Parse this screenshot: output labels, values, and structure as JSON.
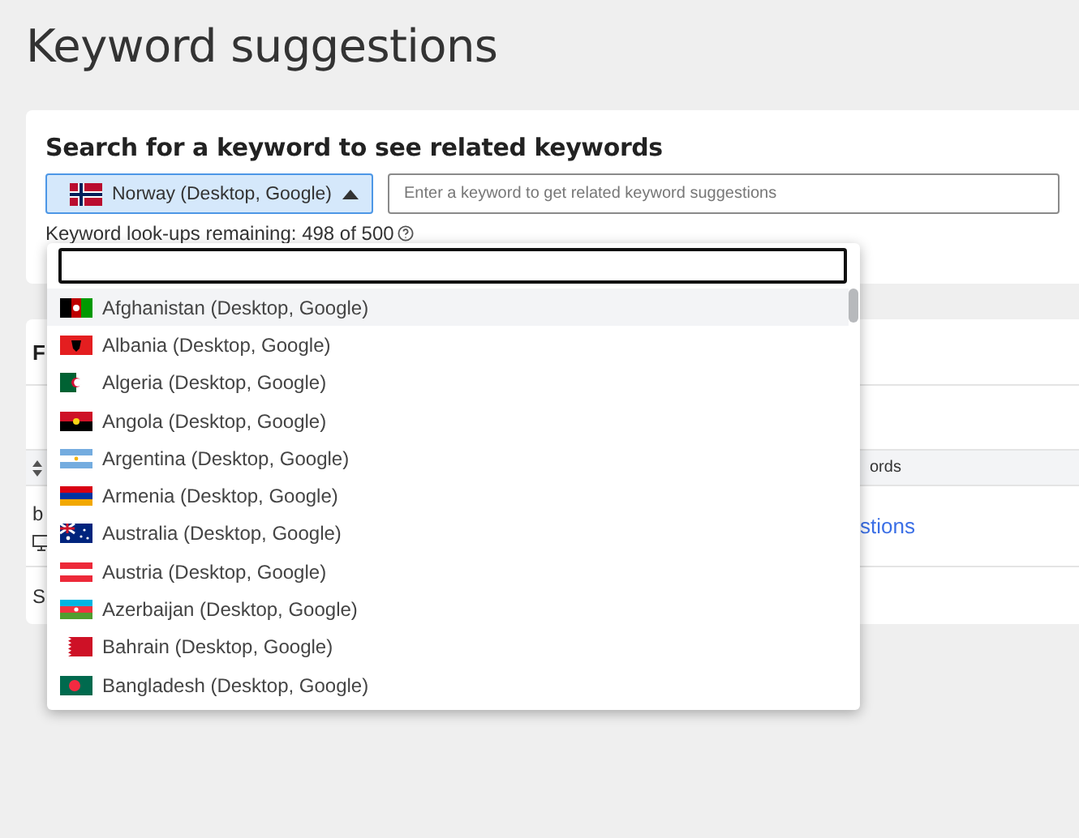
{
  "page_title": "Keyword suggestions",
  "search_card": {
    "heading": "Search for a keyword to see related keywords",
    "location": {
      "label": "Norway (Desktop, Google)",
      "expanded": true
    },
    "keyword_field": {
      "placeholder": "Enter a keyword to get related keyword suggestions"
    },
    "quota": "Keyword look-ups remaining: 498 of 500"
  },
  "results_card": {
    "title": "F",
    "header_cell": "ords",
    "row_cell": "b",
    "row_link": "stions",
    "footer": "S"
  },
  "location_menu": {
    "items": [
      {
        "label": "Afghanistan (Desktop, Google)",
        "selected": true
      },
      {
        "label": "Albania (Desktop, Google)",
        "selected": false
      },
      {
        "label": "Algeria (Desktop, Google)",
        "selected": false
      },
      {
        "label": "Angola (Desktop, Google)",
        "selected": false
      },
      {
        "label": "Argentina (Desktop, Google)",
        "selected": false
      },
      {
        "label": "Armenia (Desktop, Google)",
        "selected": false
      },
      {
        "label": "Australia (Desktop, Google)",
        "selected": false
      },
      {
        "label": "Austria (Desktop, Google)",
        "selected": false
      },
      {
        "label": "Azerbaijan (Desktop, Google)",
        "selected": false
      },
      {
        "label": "Bahrain (Desktop, Google)",
        "selected": false
      },
      {
        "label": "Bangladesh (Desktop, Google)",
        "selected": false
      }
    ]
  }
}
